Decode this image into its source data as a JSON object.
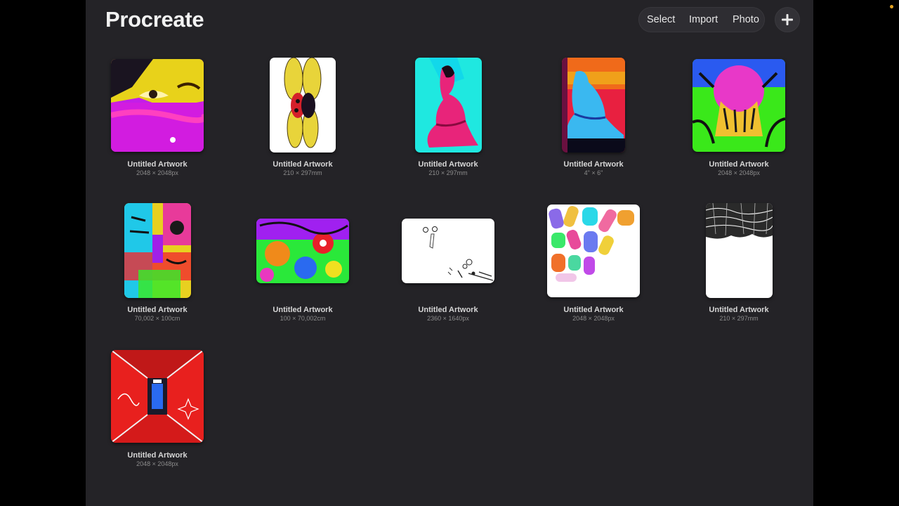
{
  "app": {
    "title": "Procreate"
  },
  "toolbar": {
    "select": "Select",
    "import": "Import",
    "photo": "Photo",
    "add_icon": "plus-icon"
  },
  "gallery": {
    "artworks": [
      {
        "name": "Untitled Artwork",
        "dims": "2048 × 2048px"
      },
      {
        "name": "Untitled Artwork",
        "dims": "210 × 297mm"
      },
      {
        "name": "Untitled Artwork",
        "dims": "210 × 297mm"
      },
      {
        "name": "Untitled Artwork",
        "dims": "4\" × 6\""
      },
      {
        "name": "Untitled Artwork",
        "dims": "2048 × 2048px"
      },
      {
        "name": "Untitled Artwork",
        "dims": "70,002 × 100cm"
      },
      {
        "name": "Untitled Artwork",
        "dims": "100 × 70,002cm"
      },
      {
        "name": "Untitled Artwork",
        "dims": "2360 × 1640px"
      },
      {
        "name": "Untitled Artwork",
        "dims": "2048 × 2048px"
      },
      {
        "name": "Untitled Artwork",
        "dims": "210 × 297mm"
      },
      {
        "name": "Untitled Artwork",
        "dims": "2048 × 2048px"
      }
    ]
  }
}
